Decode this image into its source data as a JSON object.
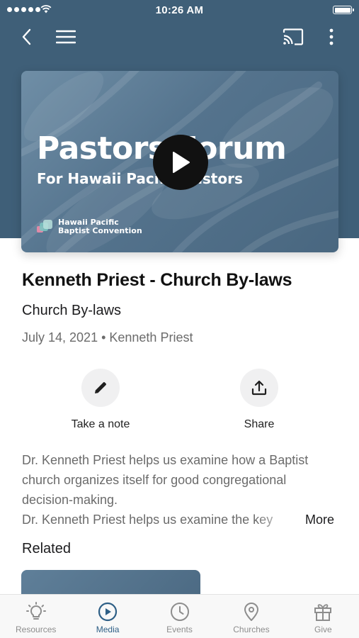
{
  "status_bar": {
    "time": "10:26 AM"
  },
  "hero": {
    "title": "Pastors Forum",
    "subtitle": "For Hawaii Pacific Pastors",
    "logo_line1": "Hawaii Pacific",
    "logo_line2": "Baptist Convention"
  },
  "media": {
    "title": "Kenneth Priest - Church By-laws",
    "subtitle": "Church By-laws",
    "meta": "July 14, 2021 • Kenneth Priest"
  },
  "actions": {
    "note_label": "Take a note",
    "share_label": "Share"
  },
  "description": {
    "paragraph": "Dr. Kenneth Priest helps us examine how a Baptist church organizes itself for good congregational decision-making.",
    "truncated_line": "Dr. Kenneth Priest helps us examine the key",
    "more_label": "More"
  },
  "related": {
    "heading": "Related"
  },
  "tabbar": {
    "tabs": [
      {
        "label": "Resources",
        "icon": "lightbulb-icon"
      },
      {
        "label": "Media",
        "icon": "play-circle-icon"
      },
      {
        "label": "Events",
        "icon": "clock-icon"
      },
      {
        "label": "Churches",
        "icon": "map-pin-icon"
      },
      {
        "label": "Give",
        "icon": "gift-icon"
      }
    ],
    "active_index": 1
  },
  "colors": {
    "header": "#3f5f78",
    "accent": "#2e5f86",
    "inactive": "#8d8d8d"
  }
}
